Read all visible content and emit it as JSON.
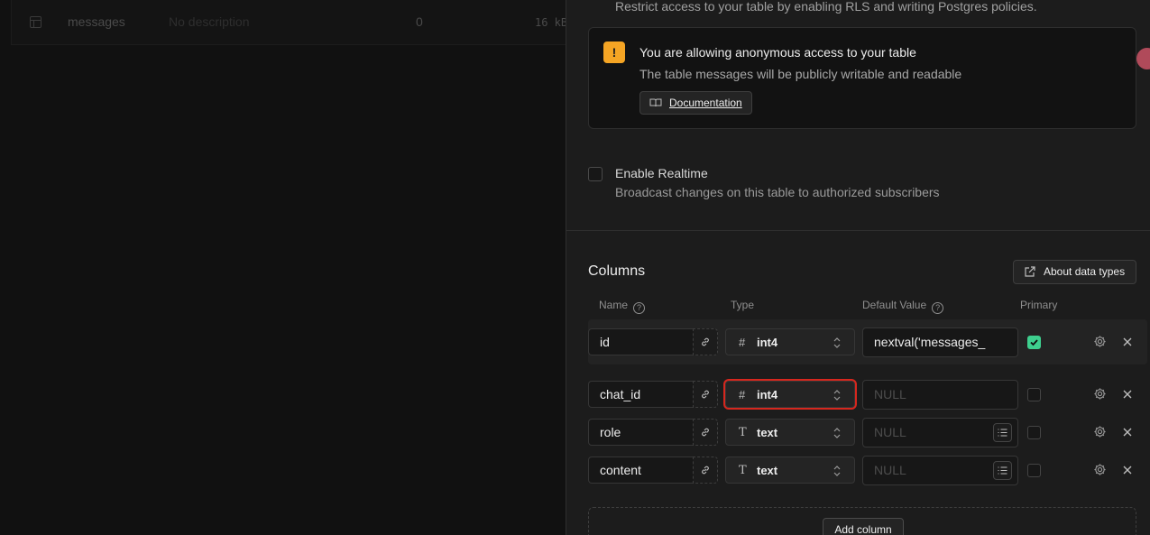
{
  "background_table": {
    "name": "messages",
    "description": "No description",
    "rows": "0",
    "size": "16 kB"
  },
  "rls": {
    "description": "Restrict access to your table by enabling RLS and writing Postgres policies."
  },
  "alert": {
    "title": "You are allowing anonymous access to your table",
    "body": "The table messages will be publicly writable and readable",
    "doc_label": "Documentation",
    "color": "#f5a524"
  },
  "realtime": {
    "label": "Enable Realtime",
    "description": "Broadcast changes on this table to authorized subscribers"
  },
  "columns": {
    "title": "Columns",
    "about_label": "About data types",
    "headers": {
      "name": "Name",
      "type": "Type",
      "default": "Default Value",
      "primary": "Primary"
    },
    "rows": [
      {
        "name": "id",
        "type": "int4",
        "type_icon": "hash-icon",
        "default": "nextval('messages_",
        "default_is_placeholder": false,
        "primary": true
      },
      {
        "name": "chat_id",
        "type": "int4",
        "type_icon": "hash-icon",
        "default": "NULL",
        "default_is_placeholder": true,
        "primary": false
      },
      {
        "name": "role",
        "type": "text",
        "type_icon": "text-type-icon",
        "default": "NULL",
        "default_is_placeholder": true,
        "primary": false
      },
      {
        "name": "content",
        "type": "text",
        "type_icon": "text-type-icon",
        "default": "NULL",
        "default_is_placeholder": true,
        "primary": false
      }
    ],
    "add_label": "Add column"
  },
  "colors": {
    "primary_check": "#3ecf8e",
    "highlight_outline": "#d6271e"
  }
}
